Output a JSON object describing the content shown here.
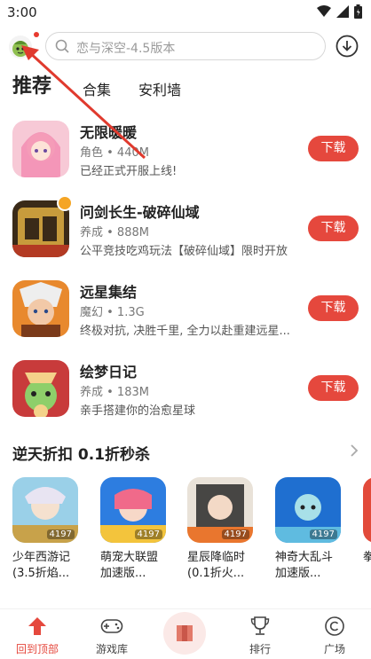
{
  "status_bar": {
    "time": "3:00"
  },
  "search": {
    "placeholder": "恋与深空-4.5版本"
  },
  "tabs": [
    {
      "label": "推荐",
      "active": true
    },
    {
      "label": "合集",
      "active": false
    },
    {
      "label": "安利墙",
      "active": false
    }
  ],
  "apps": [
    {
      "name": "无限暖暖",
      "meta": "角色 • 440M",
      "desc": "已经正式开服上线!",
      "button": "下载"
    },
    {
      "name": "问剑长生-破碎仙域",
      "meta": "养成 • 888M",
      "desc": "公平竞技吃鸡玩法【破碎仙域】限时开放",
      "button": "下载"
    },
    {
      "name": "远星集结",
      "meta": "魔幻 • 1.3G",
      "desc": "终极对抗, 决胜千里, 全力以赴重建远星...",
      "button": "下载"
    },
    {
      "name": "绘梦日记",
      "meta": "养成 • 183M",
      "desc": "亲手搭建你的治愈星球",
      "button": "下载"
    }
  ],
  "section": {
    "title": "逆天折扣 0.1折秒杀"
  },
  "discount_games": [
    {
      "label": "少年西游记(3.5折焰...",
      "tag": "4197"
    },
    {
      "label": "萌宠大联盟加速版...",
      "tag": "4197"
    },
    {
      "label": "星辰降临时(0.1折火...",
      "tag": "4197"
    },
    {
      "label": "神奇大乱斗加速版...",
      "tag": "4197"
    },
    {
      "label": "拳",
      "tag": ""
    }
  ],
  "bottom_nav": [
    {
      "label": "回到顶部",
      "icon": "home-up-icon",
      "active": true
    },
    {
      "label": "游戏库",
      "icon": "gamepad-icon",
      "active": false
    },
    {
      "label": "",
      "icon": "center-book-icon",
      "active": false
    },
    {
      "label": "排行",
      "icon": "trophy-icon",
      "active": false
    },
    {
      "label": "广场",
      "icon": "plaza-icon",
      "active": false
    }
  ],
  "colors": {
    "accent": "#e5483d",
    "text": "#222222",
    "muted": "#777777"
  }
}
